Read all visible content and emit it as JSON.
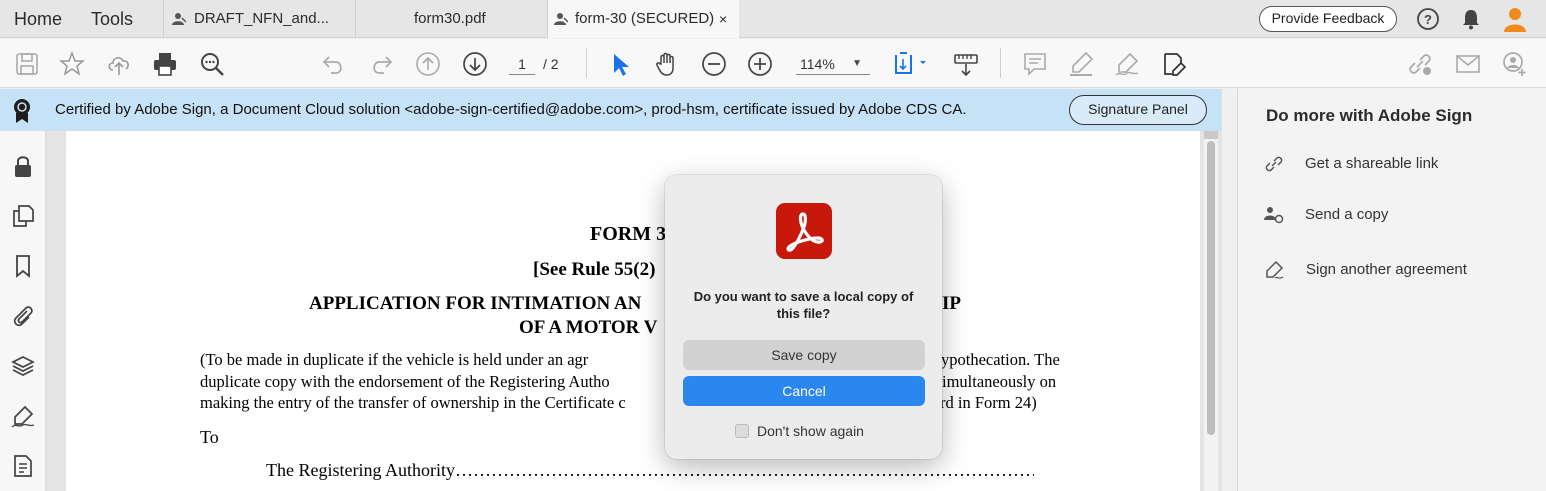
{
  "nav": {
    "home": "Home",
    "tools": "Tools"
  },
  "tabs": [
    {
      "label": "DRAFT_NFN_and..."
    },
    {
      "label": "form30.pdf"
    },
    {
      "label": "form-30 (SECURED)",
      "close": "×"
    }
  ],
  "topbar": {
    "feedback": "Provide Feedback",
    "help": "?"
  },
  "toolbar": {
    "page_current": "1",
    "page_total": "/ 2",
    "zoom": "114%",
    "zoom_caret": "▼"
  },
  "cert": {
    "text": "Certified by Adobe Sign, a Document Cloud solution <adobe-sign-certified@adobe.com>, prod-hsm, certificate issued by Adobe CDS CA.",
    "panel_button": "Signature Panel"
  },
  "document": {
    "form_title": "FORM 3",
    "rule": "[See Rule 55(2)",
    "heading1_left": "APPLICATION FOR INTIMATION AN",
    "heading1_right": "IP",
    "heading2": "OF A MOTOR V",
    "para_line1_left": "(To be made in duplicate if the vehicle is held under an agr",
    "para_line1_right": "ypothecation. The",
    "para_line2_left": "duplicate copy with the endorsement of the Registering Autho",
    "para_line2_right": "imultaneously on",
    "para_line3_left": "making the entry of the transfer of ownership in the Certificate c",
    "para_line3_right": "rd in Form 24)",
    "to": "To",
    "authority": "The Registering Authority……………………………………………………………………………………………………………………………………………………………………………………………………………………………………………………………………………"
  },
  "rightpanel": {
    "title": "Do more with Adobe Sign",
    "items": [
      {
        "label": "Get a shareable link",
        "icon": "link-icon"
      },
      {
        "label": "Send a copy",
        "icon": "user-send-icon"
      },
      {
        "label": "Sign another agreement",
        "icon": "pen-sign-icon"
      }
    ]
  },
  "dialog": {
    "message": "Do you want to save a local copy of this file?",
    "save": "Save copy",
    "cancel": "Cancel",
    "dont_show": "Don't show again",
    "dont_show_checked": false
  },
  "colors": {
    "cert_bar": "#c6e2f6",
    "primary_button": "#2b87f0",
    "acrobat_red": "#c8170b",
    "avatar": "#f08a1c",
    "toolbar_blue": "#1a73e8"
  }
}
